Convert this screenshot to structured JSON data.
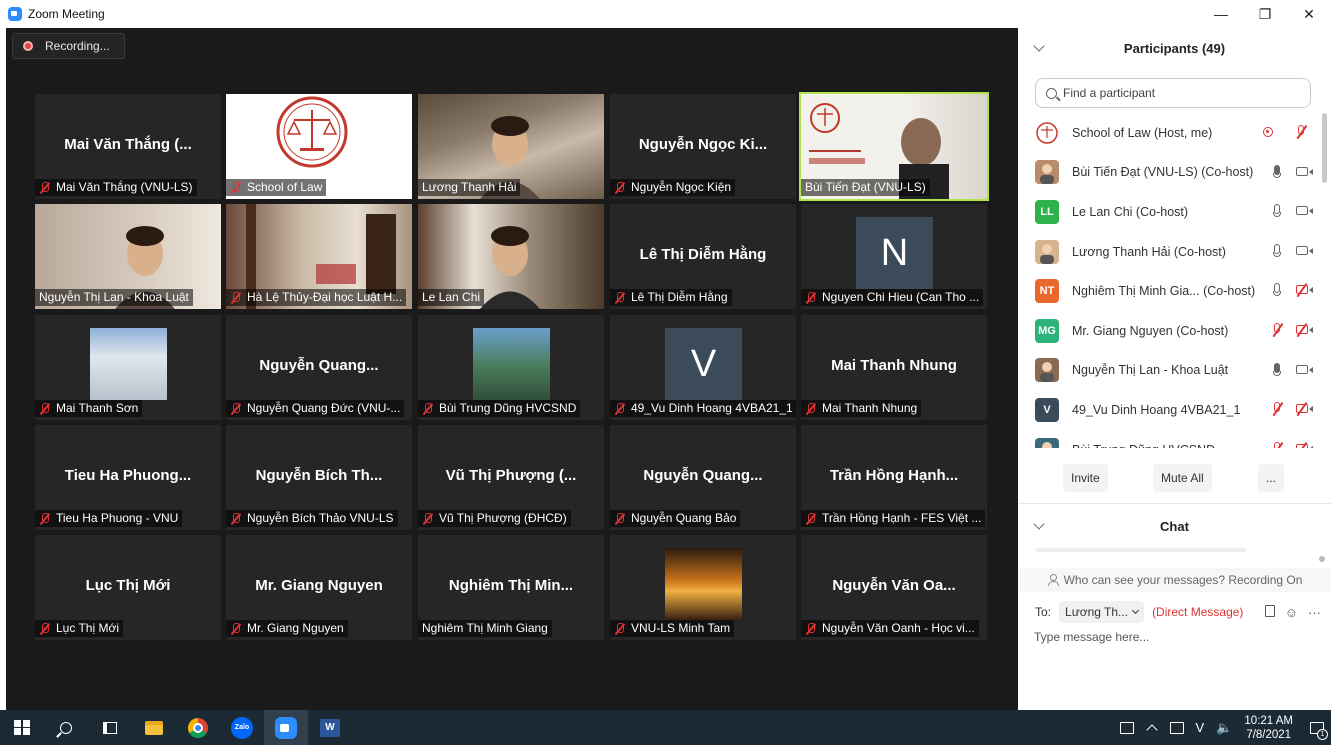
{
  "window": {
    "title": "Zoom Meeting",
    "minimize_glyph": "—",
    "restore_glyph": "❐",
    "close_glyph": "✕"
  },
  "recording": {
    "label": "Recording..."
  },
  "tiles": [
    {
      "name": "Mai Văn Thắng (...",
      "label": "Mai Văn Thắng (VNU-LS)",
      "muted": true
    },
    {
      "name": "",
      "label": "School of Law",
      "muted": true
    },
    {
      "name": "",
      "label": "Lương Thanh Hải",
      "muted": false
    },
    {
      "name": "Nguyễn Ngọc Ki...",
      "label": "Nguyễn Ngọc Kiện",
      "muted": true
    },
    {
      "name": "",
      "label": "Bùi Tiến Đạt (VNU-LS)",
      "muted": false
    },
    {
      "name": "",
      "label": "Nguyễn Thị Lan - Khoa Luật",
      "muted": false
    },
    {
      "name": "",
      "label": "Hà Lệ Thủy-Đại học Luật H...",
      "muted": true
    },
    {
      "name": "",
      "label": "Le Lan Chi",
      "muted": false
    },
    {
      "name": "Lê Thị Diễm Hằng",
      "label": "Lê Thị Diễm Hằng",
      "muted": true
    },
    {
      "name": "",
      "label": "Nguyen Chi Hieu (Can Tho ...",
      "muted": true,
      "avatar": "N"
    },
    {
      "name": "",
      "label": "Mai Thanh Sơn",
      "muted": true
    },
    {
      "name": "Nguyễn  Quang...",
      "label": "Nguyễn Quang Đức (VNU-...",
      "muted": true
    },
    {
      "name": "",
      "label": "Bùi Trung Dũng HVCSND",
      "muted": true
    },
    {
      "name": "",
      "label": "49_Vu Dinh Hoang 4VBA21_1",
      "muted": true,
      "avatar": "V"
    },
    {
      "name": "Mai Thanh Nhung",
      "label": "Mai Thanh Nhung",
      "muted": true
    },
    {
      "name": "Tieu Ha Phuong...",
      "label": "Tieu Ha Phuong - VNU",
      "muted": true
    },
    {
      "name": "Nguyễn Bích Th...",
      "label": "Nguyễn Bích Thảo VNU-LS",
      "muted": true
    },
    {
      "name": "Vũ Thị Phượng (...",
      "label": "Vũ Thị Phượng (ĐHCĐ)",
      "muted": true
    },
    {
      "name": "Nguyễn  Quang...",
      "label": "Nguyễn Quang Bảo",
      "muted": true
    },
    {
      "name": "Trần Hồng Hạnh...",
      "label": "Trần Hồng Hạnh - FES Việt ...",
      "muted": true
    },
    {
      "name": "Lục Thị Mới",
      "label": "Lục Thị Mới",
      "muted": true
    },
    {
      "name": "Mr. Giang Nguyen",
      "label": "Mr. Giang Nguyen",
      "muted": true
    },
    {
      "name": "Nghiêm Thị Min...",
      "label": "Nghiêm Thị Minh Giang",
      "muted": false
    },
    {
      "name": "",
      "label": "VNU-LS Minh Tam",
      "muted": true
    },
    {
      "name": "Nguyễn Văn Oa...",
      "label": "Nguyễn Văn Oanh - Học vi...",
      "muted": true
    }
  ],
  "participants_panel": {
    "title": "Participants (49)",
    "search_placeholder": "Find a participant",
    "participants": [
      {
        "name": "School of Law (Host, me)",
        "initials": "",
        "color": "#ffffff"
      },
      {
        "name": "Bùi Tiến Đạt (VNU-LS) (Co-host)",
        "initials": "",
        "color": "#b98b6a"
      },
      {
        "name": "Le Lan Chi (Co-host)",
        "initials": "LL",
        "color": "#2db34a"
      },
      {
        "name": "Lương Thanh Hải (Co-host)",
        "initials": "",
        "color": "#d9b38c"
      },
      {
        "name": "Nghiêm Thị Minh Gia...  (Co-host)",
        "initials": "NT",
        "color": "#e8692b"
      },
      {
        "name": "Mr. Giang Nguyen (Co-host)",
        "initials": "MG",
        "color": "#2db37a"
      },
      {
        "name": "Nguyễn Thị Lan - Khoa Luật",
        "initials": "",
        "color": "#8a6a55"
      },
      {
        "name": "49_Vu Dinh Hoang 4VBA21_1",
        "initials": "V",
        "color": "#3c4b59"
      },
      {
        "name": "Bùi Trung Dũng HVCSND",
        "initials": "",
        "color": "#3a6a7a"
      }
    ],
    "invite_label": "Invite",
    "mute_all_label": "Mute All",
    "more_label": "..."
  },
  "chat_panel": {
    "title": "Chat",
    "notice": "Who can see your messages? Recording On",
    "to_label": "To:",
    "to_value": "Lương Th...",
    "direct_message": "(Direct Message)",
    "more_label": "···",
    "input_placeholder": "Type message here..."
  },
  "taskbar": {
    "zalo_label": "Zalo",
    "word_label": "W",
    "tray_wifi": "V",
    "tray_volume": "🔈",
    "time": "10:21 AM",
    "date": "7/8/2021",
    "notifications": "1"
  },
  "colors": {
    "speaker_highlight": "#b4e24c",
    "muted_red": "#e03131",
    "zoom_blue": "#2d8cff",
    "video_bg": "#1a1a1a"
  }
}
